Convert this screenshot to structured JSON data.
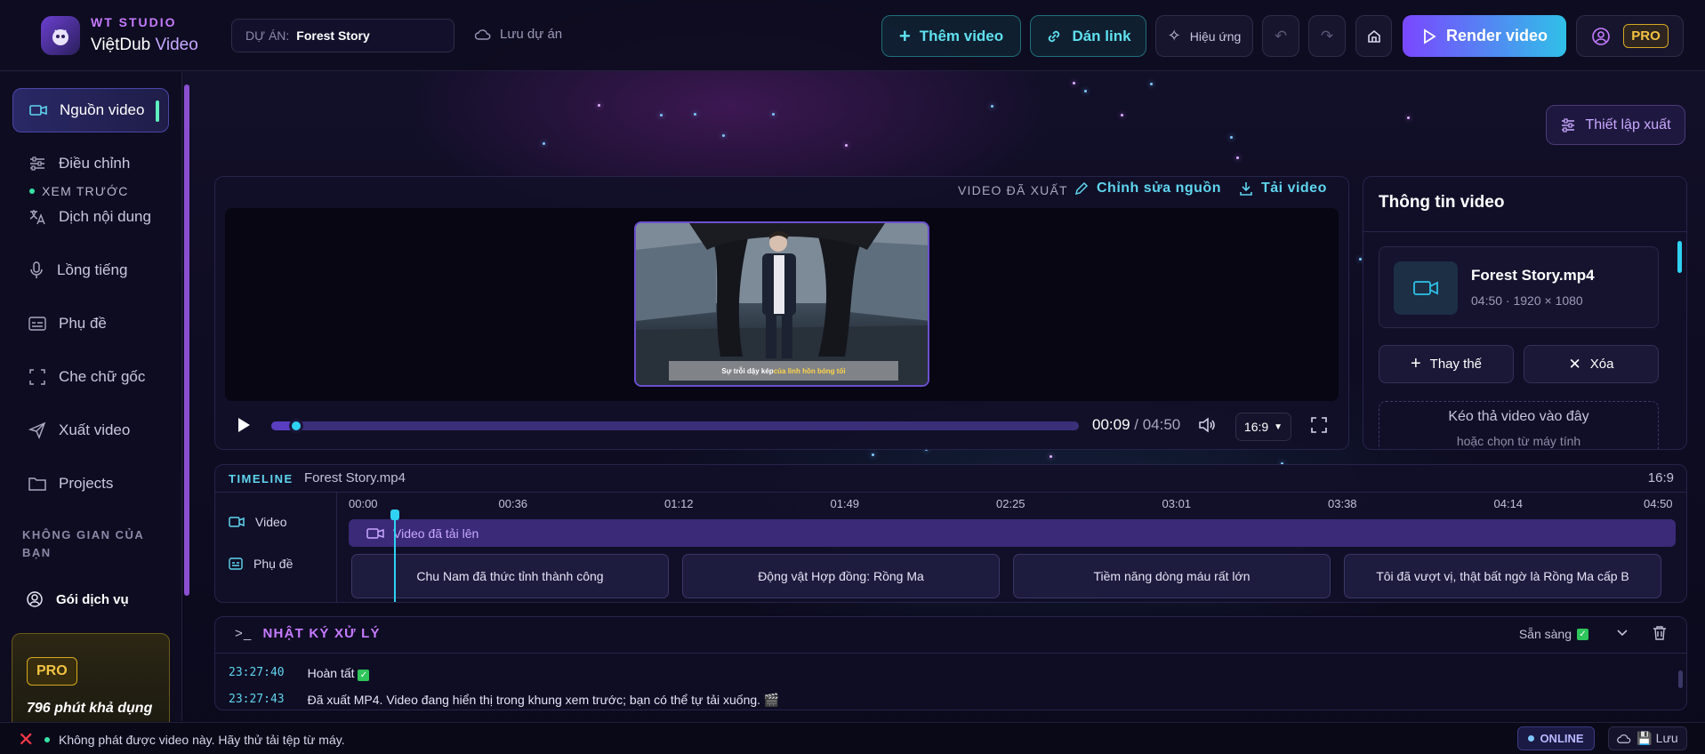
{
  "brand": {
    "studio": "WT STUDIO",
    "name": "ViệtDub",
    "name_accent": " Video"
  },
  "project": {
    "label": "DỰ ÁN:",
    "value": "Forest Story",
    "save": "Lưu dự án"
  },
  "toolbar": {
    "add_video": "Thêm video",
    "paste_link": "Dán link",
    "effects": "Hiệu ứng",
    "render": "Render video",
    "pro": "PRO"
  },
  "sidebar": {
    "items": [
      {
        "label": "Nguồn video",
        "icon": "video-camera-icon",
        "active": true
      },
      {
        "label": "Điều chỉnh",
        "icon": "sliders-icon"
      },
      {
        "label": "Dịch nội dung",
        "icon": "translate-icon"
      },
      {
        "label": "Lồng tiếng",
        "icon": "microphone-icon"
      },
      {
        "label": "Phụ đề",
        "icon": "subtitles-icon"
      },
      {
        "label": "Che chữ gốc",
        "icon": "crop-icon"
      },
      {
        "label": "Xuất video",
        "icon": "send-icon"
      },
      {
        "label": "Projects",
        "icon": "folder-icon"
      }
    ],
    "workspace_title": "KHÔNG GIAN CỦA BẠN",
    "service": "Gói dịch vụ",
    "pro_card": {
      "badge": "PRO",
      "minutes": "796 phút khả dụng"
    }
  },
  "export_settings": "Thiết lập xuất",
  "preview": {
    "title": "XEM TRƯỚC",
    "exported": "VIDEO ĐÃ XUẤT",
    "edit_source": "Chỉnh sửa nguồn",
    "download": "Tải video",
    "subtitle_plain": "Sự trỗi dậy kép ",
    "subtitle_highlight": "của linh hồn bóng tối",
    "current_time": "00:09",
    "duration": "04:50",
    "progress": 0.031,
    "aspect": "16:9"
  },
  "info": {
    "title": "Thông tin video",
    "file_name": "Forest Story.mp4",
    "file_meta": "04:50 · 1920 × 1080",
    "replace": "Thay thế",
    "delete": "Xóa",
    "drop_title": "Kéo thả video vào đây",
    "drop_sub": "hoặc chọn từ máy tính"
  },
  "timeline": {
    "label": "TIMELINE",
    "file": "Forest Story.mp4",
    "ratio": "16:9",
    "track_video": "Video",
    "track_sub": "Phụ đề",
    "ticks": [
      "00:00",
      "00:36",
      "01:12",
      "01:49",
      "02:25",
      "03:01",
      "03:38",
      "04:14",
      "04:50"
    ],
    "video_clip": "Video đã tải lên",
    "subtitle_clips": [
      "Chu Nam đã thức tỉnh thành công",
      "Động vật Hợp đồng: Rồng Ma",
      "Tiềm năng dòng máu rất lớn",
      "Tôi đã vượt vị, thật bất ngờ là Rồng Ma cấp B"
    ]
  },
  "log": {
    "title": "NHẬT KÝ XỬ LÝ",
    "status": "Sẵn sàng",
    "lines": [
      {
        "time": "23:27:40",
        "text": "Hoàn tất"
      },
      {
        "time": "23:27:43",
        "text": "Đã xuất MP4. Video đang hiển thị trong khung xem trước; bạn có thể tự tải xuống. 🎬"
      }
    ]
  },
  "statusbar": {
    "message": "Không phát được video này. Hãy thử tải tệp từ máy.",
    "online": "ONLINE",
    "save": "💾 Lưu"
  },
  "colors": {
    "accent_cyan": "#5fd5ef",
    "accent_purple": "#c67bff",
    "pro_gold": "#f3c342",
    "error_red": "#ff3a4a",
    "online_green": "#36e3a5"
  }
}
